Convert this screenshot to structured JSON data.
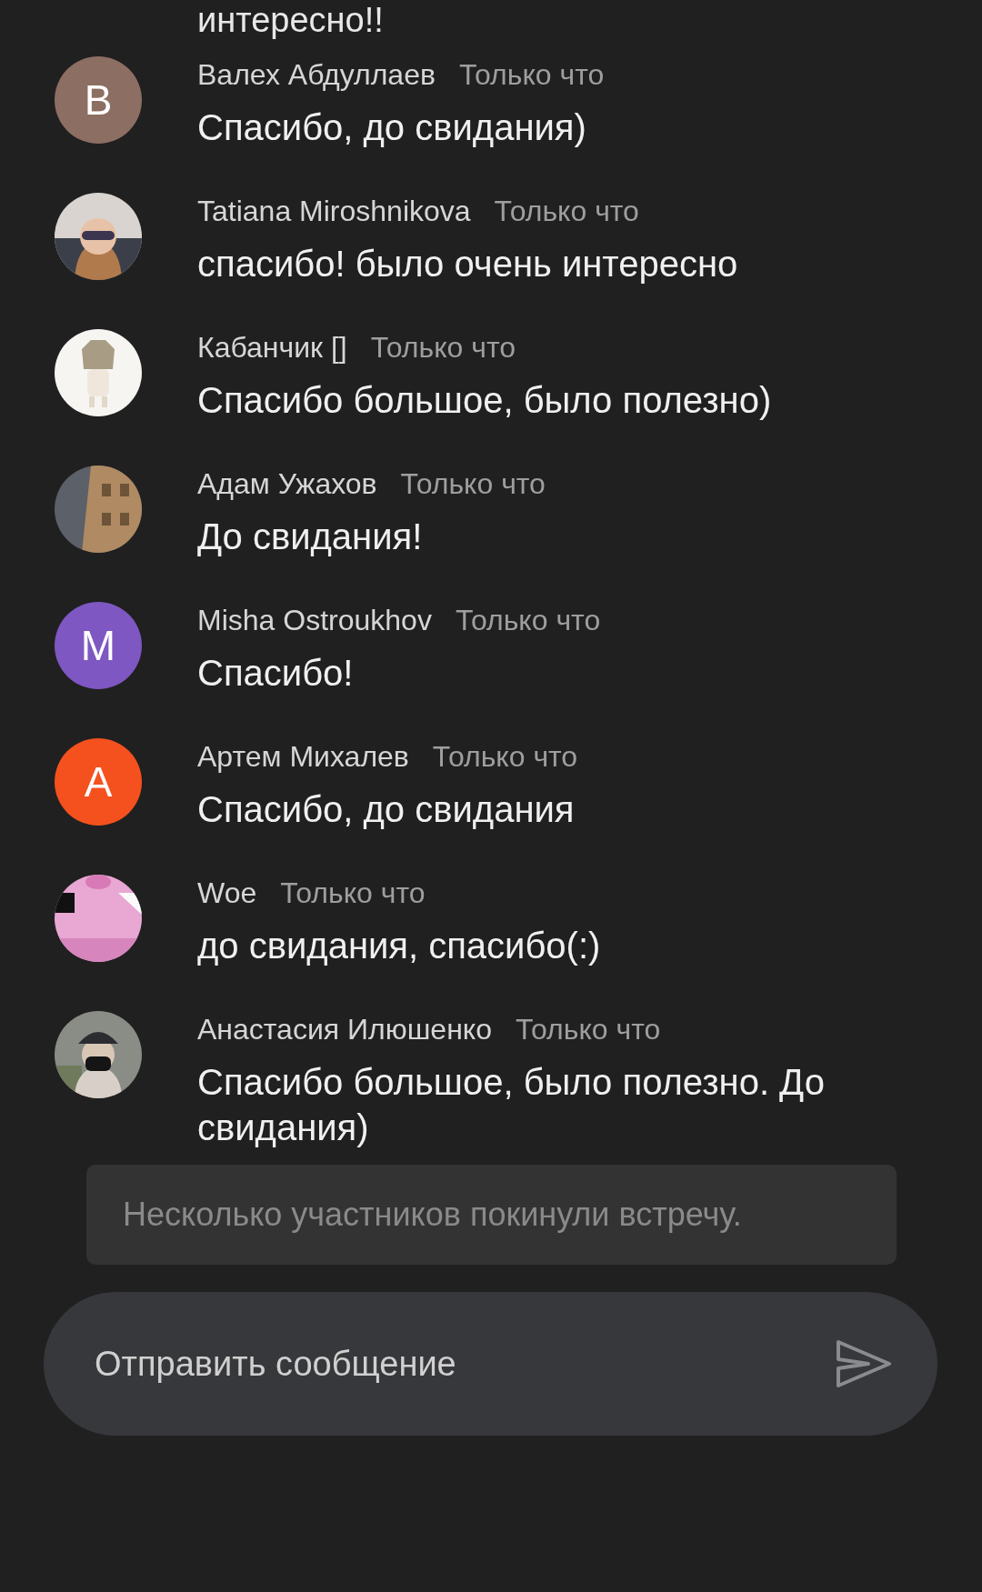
{
  "previous_message_tail": "интересно!!",
  "messages": [
    {
      "author": "Валех Абдуллаев",
      "time": "Только что",
      "text": "Спасибо, до свидания)",
      "avatar": {
        "kind": "letter",
        "letter": "В",
        "color": "#8d6e63"
      }
    },
    {
      "author": "Tatiana Miroshnikova",
      "time": "Только что",
      "text": "спасибо! было очень интересно"
    },
    {
      "author": "Кабанчик []",
      "time": "Только что",
      "text": "Спасибо большое, было полезно)"
    },
    {
      "author": "Адам Ужахов",
      "time": "Только что",
      "text": "До свидания!"
    },
    {
      "author": "Misha Ostroukhov",
      "time": "Только что",
      "text": "Спасибо!",
      "avatar": {
        "kind": "letter",
        "letter": "M",
        "color": "#7e57c2"
      }
    },
    {
      "author": "Артем Михалев",
      "time": "Только что",
      "text": "Спасибо, до свидания",
      "avatar": {
        "kind": "letter",
        "letter": "А",
        "color": "#f4511e"
      }
    },
    {
      "author": "Woe",
      "time": "Только что",
      "text": "до свидания, спасибо(:)"
    },
    {
      "author": "Анастасия Илюшенко",
      "time": "Только что",
      "text": "Спасибо большое, было полезно. До свидания)"
    }
  ],
  "toast": {
    "text": "Несколько участников покинули встречу."
  },
  "composer": {
    "placeholder": "Отправить сообщение"
  }
}
